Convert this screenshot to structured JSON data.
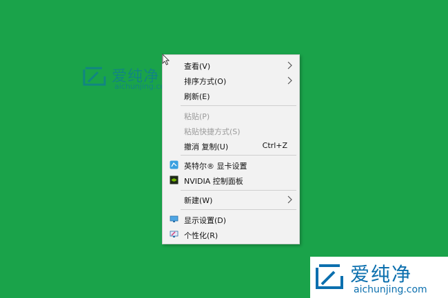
{
  "watermark": {
    "brand": "爱纯净",
    "url": "aichunjing.com"
  },
  "context_menu": {
    "items": [
      {
        "label": "查看(V)",
        "submenu": true
      },
      {
        "label": "排序方式(O)",
        "submenu": true
      },
      {
        "label": "刷新(E)"
      },
      {
        "label": "粘贴(P)",
        "disabled": true
      },
      {
        "label": "粘贴快捷方式(S)",
        "disabled": true
      },
      {
        "label": "撤消 复制(U)",
        "shortcut": "Ctrl+Z"
      },
      {
        "label": "英特尔® 显卡设置",
        "icon": "intel-graphics-icon"
      },
      {
        "label": "NVIDIA 控制面板",
        "icon": "nvidia-icon"
      },
      {
        "label": "新建(W)",
        "submenu": true
      },
      {
        "label": "显示设置(D)",
        "icon": "display-settings-icon"
      },
      {
        "label": "个性化(R)",
        "icon": "personalize-icon"
      }
    ]
  },
  "colors": {
    "desktop_background": "#1aa34a",
    "menu_background": "#f2f2f2",
    "watermark_blue": "#0b6fae"
  }
}
